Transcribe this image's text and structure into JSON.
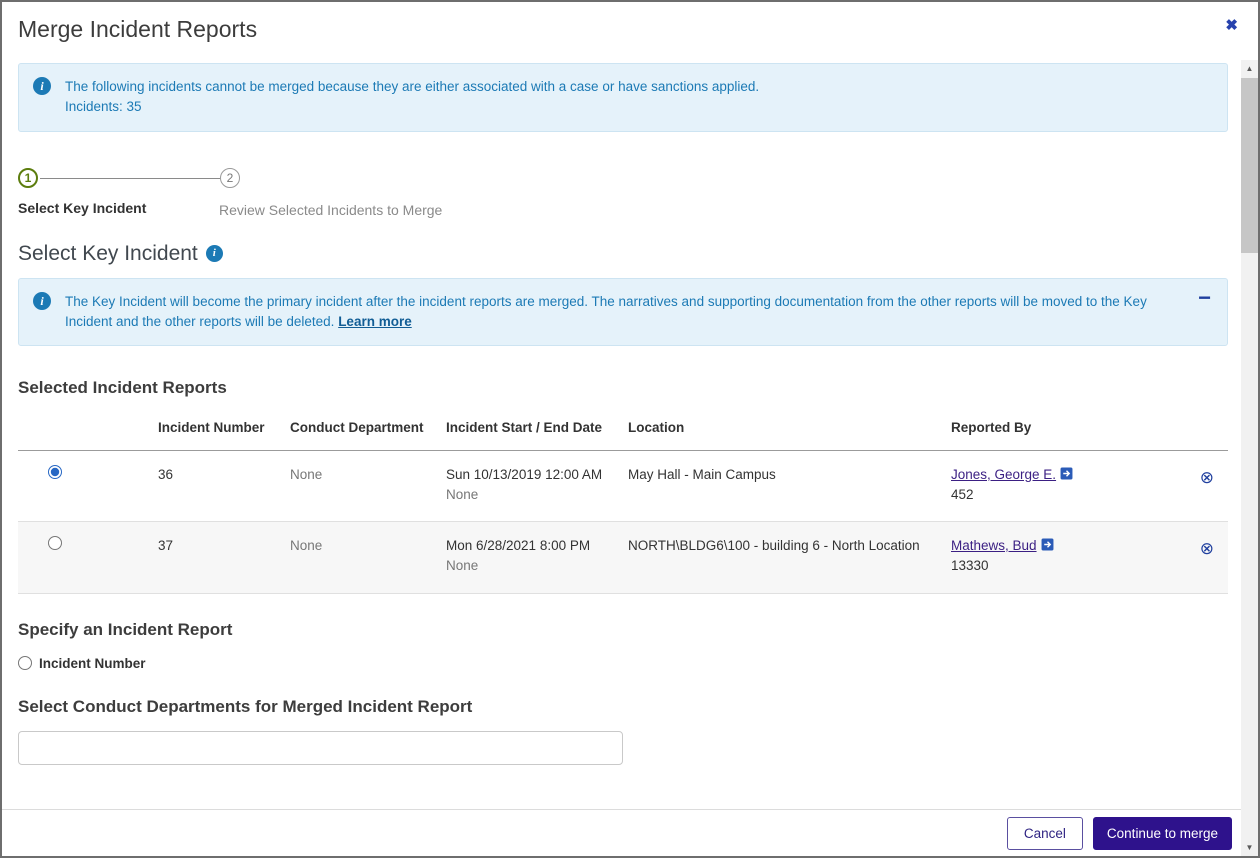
{
  "modal": {
    "title": "Merge Incident Reports"
  },
  "icons": {
    "close": "✖",
    "info": "i",
    "collapse_minus": "−",
    "remove": "⊗",
    "scroll_up": "▲",
    "scroll_down": "▼"
  },
  "alert_top": {
    "line1": "The following incidents cannot be merged because they are either associated with a case or have sanctions applied.",
    "line2": "Incidents: 35"
  },
  "stepper": {
    "steps": [
      {
        "number": "1",
        "label": "Select Key Incident"
      },
      {
        "number": "2",
        "label": "Review Selected Incidents to Merge"
      }
    ]
  },
  "key_incident_section": {
    "title": "Select Key Incident"
  },
  "alert_key": {
    "text": "The Key Incident will become the primary incident after the incident reports are merged. The narratives and supporting documentation from the other reports will be moved to the Key Incident and the other reports will be deleted.",
    "link_label": "Learn more"
  },
  "selected_reports": {
    "title": "Selected Incident Reports",
    "columns": [
      "Incident Number",
      "Conduct Department",
      "Incident Start / End Date",
      "Location",
      "Reported By"
    ],
    "rows": [
      {
        "checked_attr": "checked",
        "incident_number": "36",
        "conduct_department": "None",
        "start_date": "Sun 10/13/2019 12:00 AM",
        "end_date": "None",
        "location": "May Hall - Main Campus",
        "reported_by": "Jones, George E.",
        "reporter_id": "452"
      },
      {
        "incident_number": "37",
        "conduct_department": "None",
        "start_date": "Mon 6/28/2021 8:00 PM",
        "end_date": "None",
        "location": "NORTH\\BLDG6\\100 - building 6 - North Location",
        "reported_by": "Mathews, Bud",
        "reporter_id": "13330"
      }
    ]
  },
  "specify_section": {
    "title": "Specify an Incident Report",
    "radio_label": "Incident Number"
  },
  "conduct_section": {
    "title": "Select Conduct Departments for Merged Incident Report",
    "input_value": ""
  },
  "footer": {
    "cancel_label": "Cancel",
    "continue_label": "Continue to merge"
  },
  "colors": {
    "alert_blue_text": "#1c7ab5",
    "alert_blue_bg": "#e5f2fa",
    "step_active_green": "#5c7d0e",
    "link_purple": "#3b1f83",
    "continue_bg": "#2e128c",
    "close_blue": "#2742ad"
  }
}
